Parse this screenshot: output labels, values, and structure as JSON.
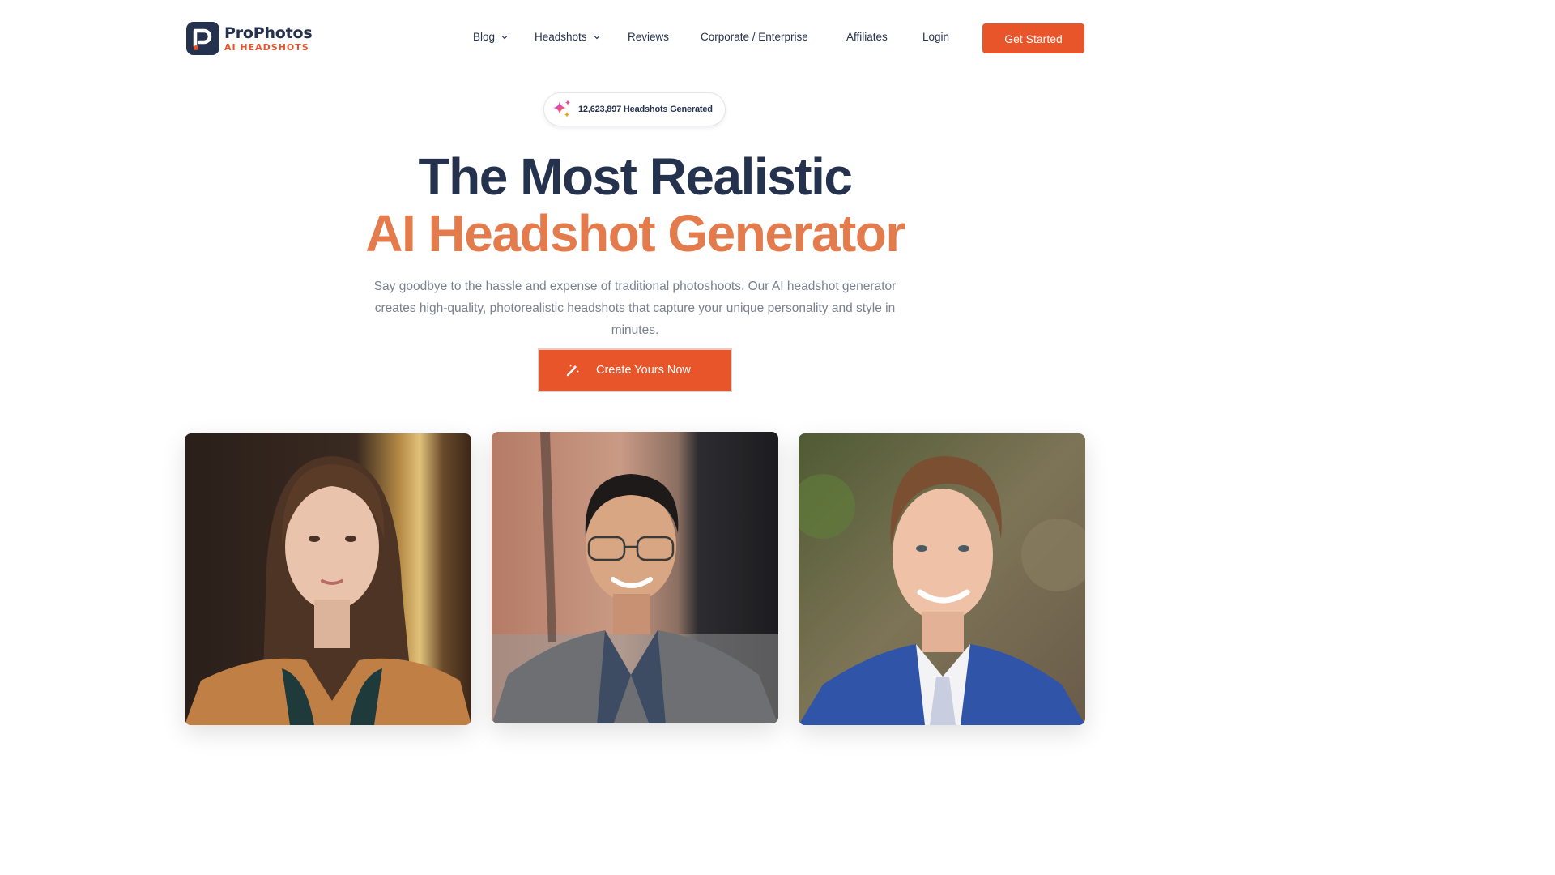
{
  "brand": {
    "name": "ProPhotos",
    "tagline": "AI HEADSHOTS"
  },
  "nav": {
    "items": [
      {
        "label": "Blog",
        "dropdown": true
      },
      {
        "label": "Headshots",
        "dropdown": true
      },
      {
        "label": "Reviews",
        "dropdown": false
      },
      {
        "label": "Corporate / Enterprise",
        "dropdown": false
      },
      {
        "label": "Affiliates",
        "dropdown": false
      },
      {
        "label": "Login",
        "dropdown": false
      }
    ],
    "cta_label": "Get Started"
  },
  "badge": {
    "count_text": "12,623,897 Headshots Generated",
    "icon": "sparkles-icon"
  },
  "hero": {
    "title_line1": "The Most Realistic",
    "title_line2": "AI Headshot Generator",
    "subtitle": "Say goodbye to the hassle and expense of traditional photoshoots. Our AI headshot generator creates high-quality, photorealistic headshots that capture your unique personality and style in minutes.",
    "cta_label": "Create Yours Now",
    "cta_icon": "magic-wand-icon"
  },
  "colors": {
    "brand_navy": "#25324d",
    "brand_orange": "#e8552b",
    "title_orange": "#e47b4c",
    "muted_text": "#7b8090"
  },
  "gallery": {
    "images": [
      "headshot-woman-portrait",
      "headshot-man-glasses-portrait",
      "headshot-man-blue-suit-portrait"
    ]
  }
}
